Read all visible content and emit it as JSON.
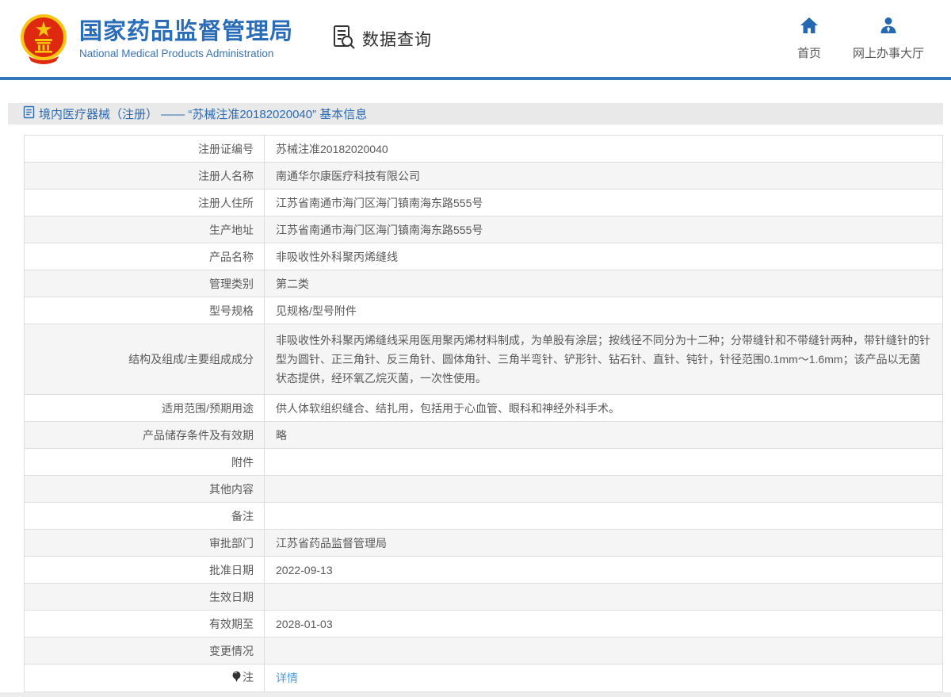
{
  "header": {
    "org_name_cn": "国家药品监督管理局",
    "org_name_en": "National Medical Products Administration",
    "data_query_label": "数据查询",
    "nav": [
      {
        "label": "首页",
        "icon": "home-icon"
      },
      {
        "label": "网上办事大厅",
        "icon": "user-icon"
      }
    ]
  },
  "title_bar": {
    "text": "境内医疗器械（注册） —— “苏械注准20182020040” 基本信息"
  },
  "table": {
    "rows": [
      {
        "label": "注册证编号",
        "value": "苏械注准20182020040"
      },
      {
        "label": "注册人名称",
        "value": "南通华尔康医疗科技有限公司"
      },
      {
        "label": "注册人住所",
        "value": "江苏省南通市海门区海门镇南海东路555号"
      },
      {
        "label": "生产地址",
        "value": "江苏省南通市海门区海门镇南海东路555号"
      },
      {
        "label": "产品名称",
        "value": "非吸收性外科聚丙烯缝线"
      },
      {
        "label": "管理类别",
        "value": "第二类"
      },
      {
        "label": "型号规格",
        "value": "见规格/型号附件"
      },
      {
        "label": "结构及组成/主要组成成分",
        "value": "非吸收性外科聚丙烯缝线采用医用聚丙烯材料制成，为单股有涂层；按线径不同分为十二种；分带缝针和不带缝针两种，带针缝针的针型为圆针、正三角针、反三角针、圆体角针、三角半弯针、铲形针、钻石针、直针、钝针，针径范围0.1mm～1.6mm；该产品以无菌状态提供，经环氧乙烷灭菌，一次性使用。",
        "multiline": true
      },
      {
        "label": "适用范围/预期用途",
        "value": "供人体软组织缝合、结扎用，包括用于心血管、眼科和神经外科手术。"
      },
      {
        "label": "产品储存条件及有效期",
        "value": "略"
      },
      {
        "label": "附件",
        "value": ""
      },
      {
        "label": "其他内容",
        "value": ""
      },
      {
        "label": "备注",
        "value": ""
      },
      {
        "label": "审批部门",
        "value": "江苏省药品监督管理局"
      },
      {
        "label": "批准日期",
        "value": "2022-09-13"
      },
      {
        "label": "生效日期",
        "value": ""
      },
      {
        "label": "有效期至",
        "value": "2028-01-03"
      },
      {
        "label": "变更情况",
        "value": ""
      },
      {
        "label": "注",
        "value": "详情",
        "is_link": true,
        "label_icon": "bulb-icon"
      }
    ]
  },
  "colors": {
    "brand_blue": "#2b6cb8",
    "divider_blue": "#3579bd",
    "link_blue": "#4f9bd8",
    "title_bar_bg": "#e9e9e9",
    "alt_row_bg": "#f5f5f5",
    "emblem_red": "#de2910",
    "emblem_gold": "#f7c50d"
  }
}
